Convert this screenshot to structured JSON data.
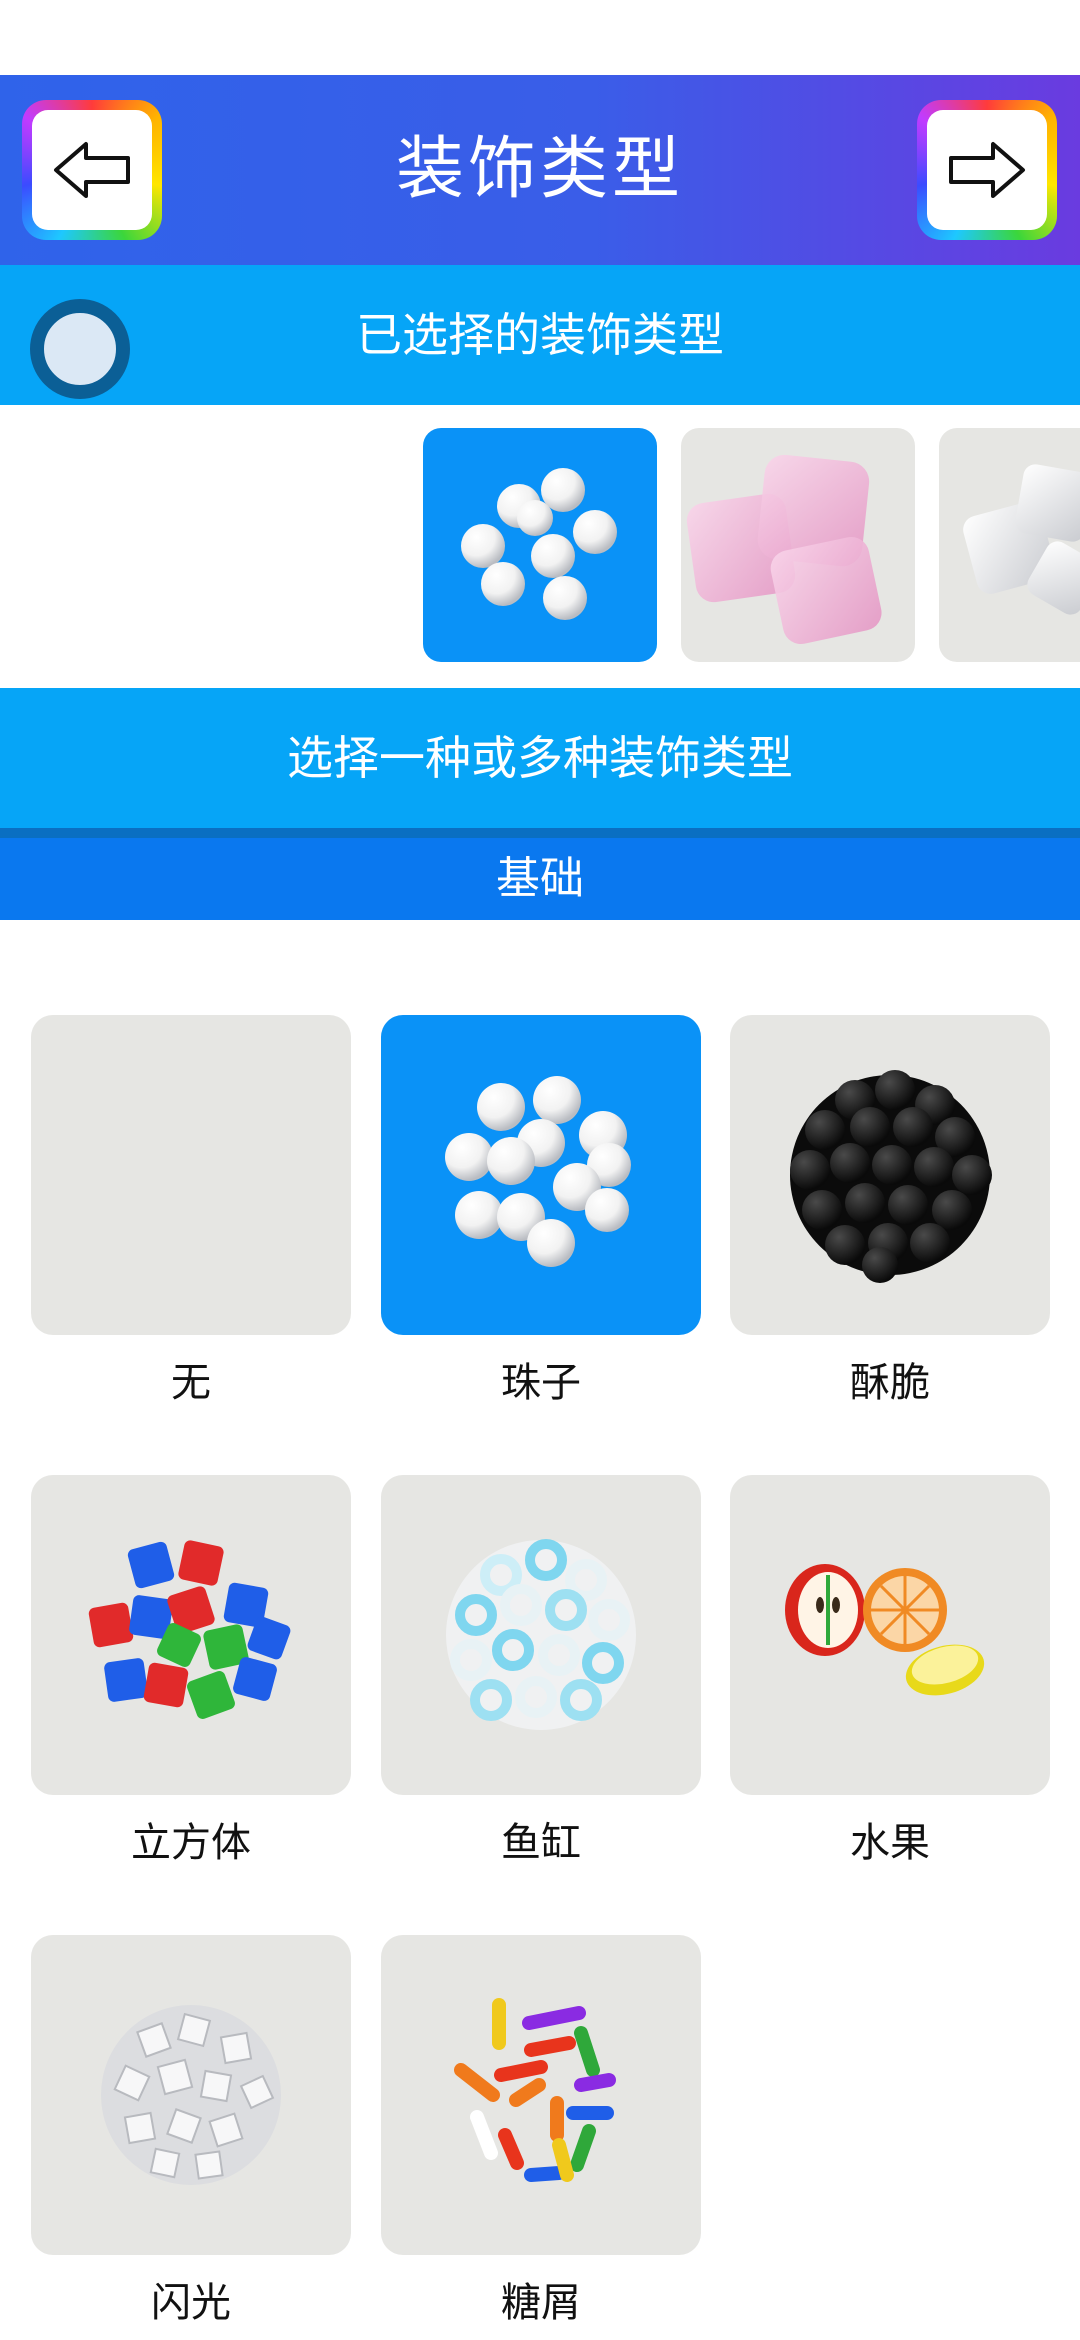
{
  "header": {
    "title": "装饰类型",
    "back_icon": "arrow-left-icon",
    "next_icon": "arrow-right-icon"
  },
  "selected_section": {
    "label": "已选择的装饰类型",
    "items": [
      "beads-thumbnail",
      "pink-cubes-thumbnail",
      "white-cubes-thumbnail"
    ]
  },
  "choose_bar": {
    "label": "选择一种或多种装饰类型"
  },
  "section": {
    "label": "基础"
  },
  "decorations": [
    {
      "label": "无",
      "icon": "none-icon",
      "selected": false
    },
    {
      "label": "珠子",
      "icon": "beads-icon",
      "selected": true
    },
    {
      "label": "酥脆",
      "icon": "crunchy-ball-icon",
      "selected": false
    },
    {
      "label": "立方体",
      "icon": "cubes-icon",
      "selected": false
    },
    {
      "label": "鱼缸",
      "icon": "fishbowl-beads-icon",
      "selected": false
    },
    {
      "label": "水果",
      "icon": "fruit-slices-icon",
      "selected": false
    },
    {
      "label": "闪光",
      "icon": "glitter-ball-icon",
      "selected": false
    },
    {
      "label": "糖屑",
      "icon": "sprinkles-icon",
      "selected": false
    }
  ],
  "colors": {
    "header_start": "#2f63ea",
    "header_end": "#6a3be0",
    "bar": "#06a5f7",
    "section": "#0a78ef",
    "selected_tile": "#0a92f7",
    "tile": "#e6e6e3"
  }
}
